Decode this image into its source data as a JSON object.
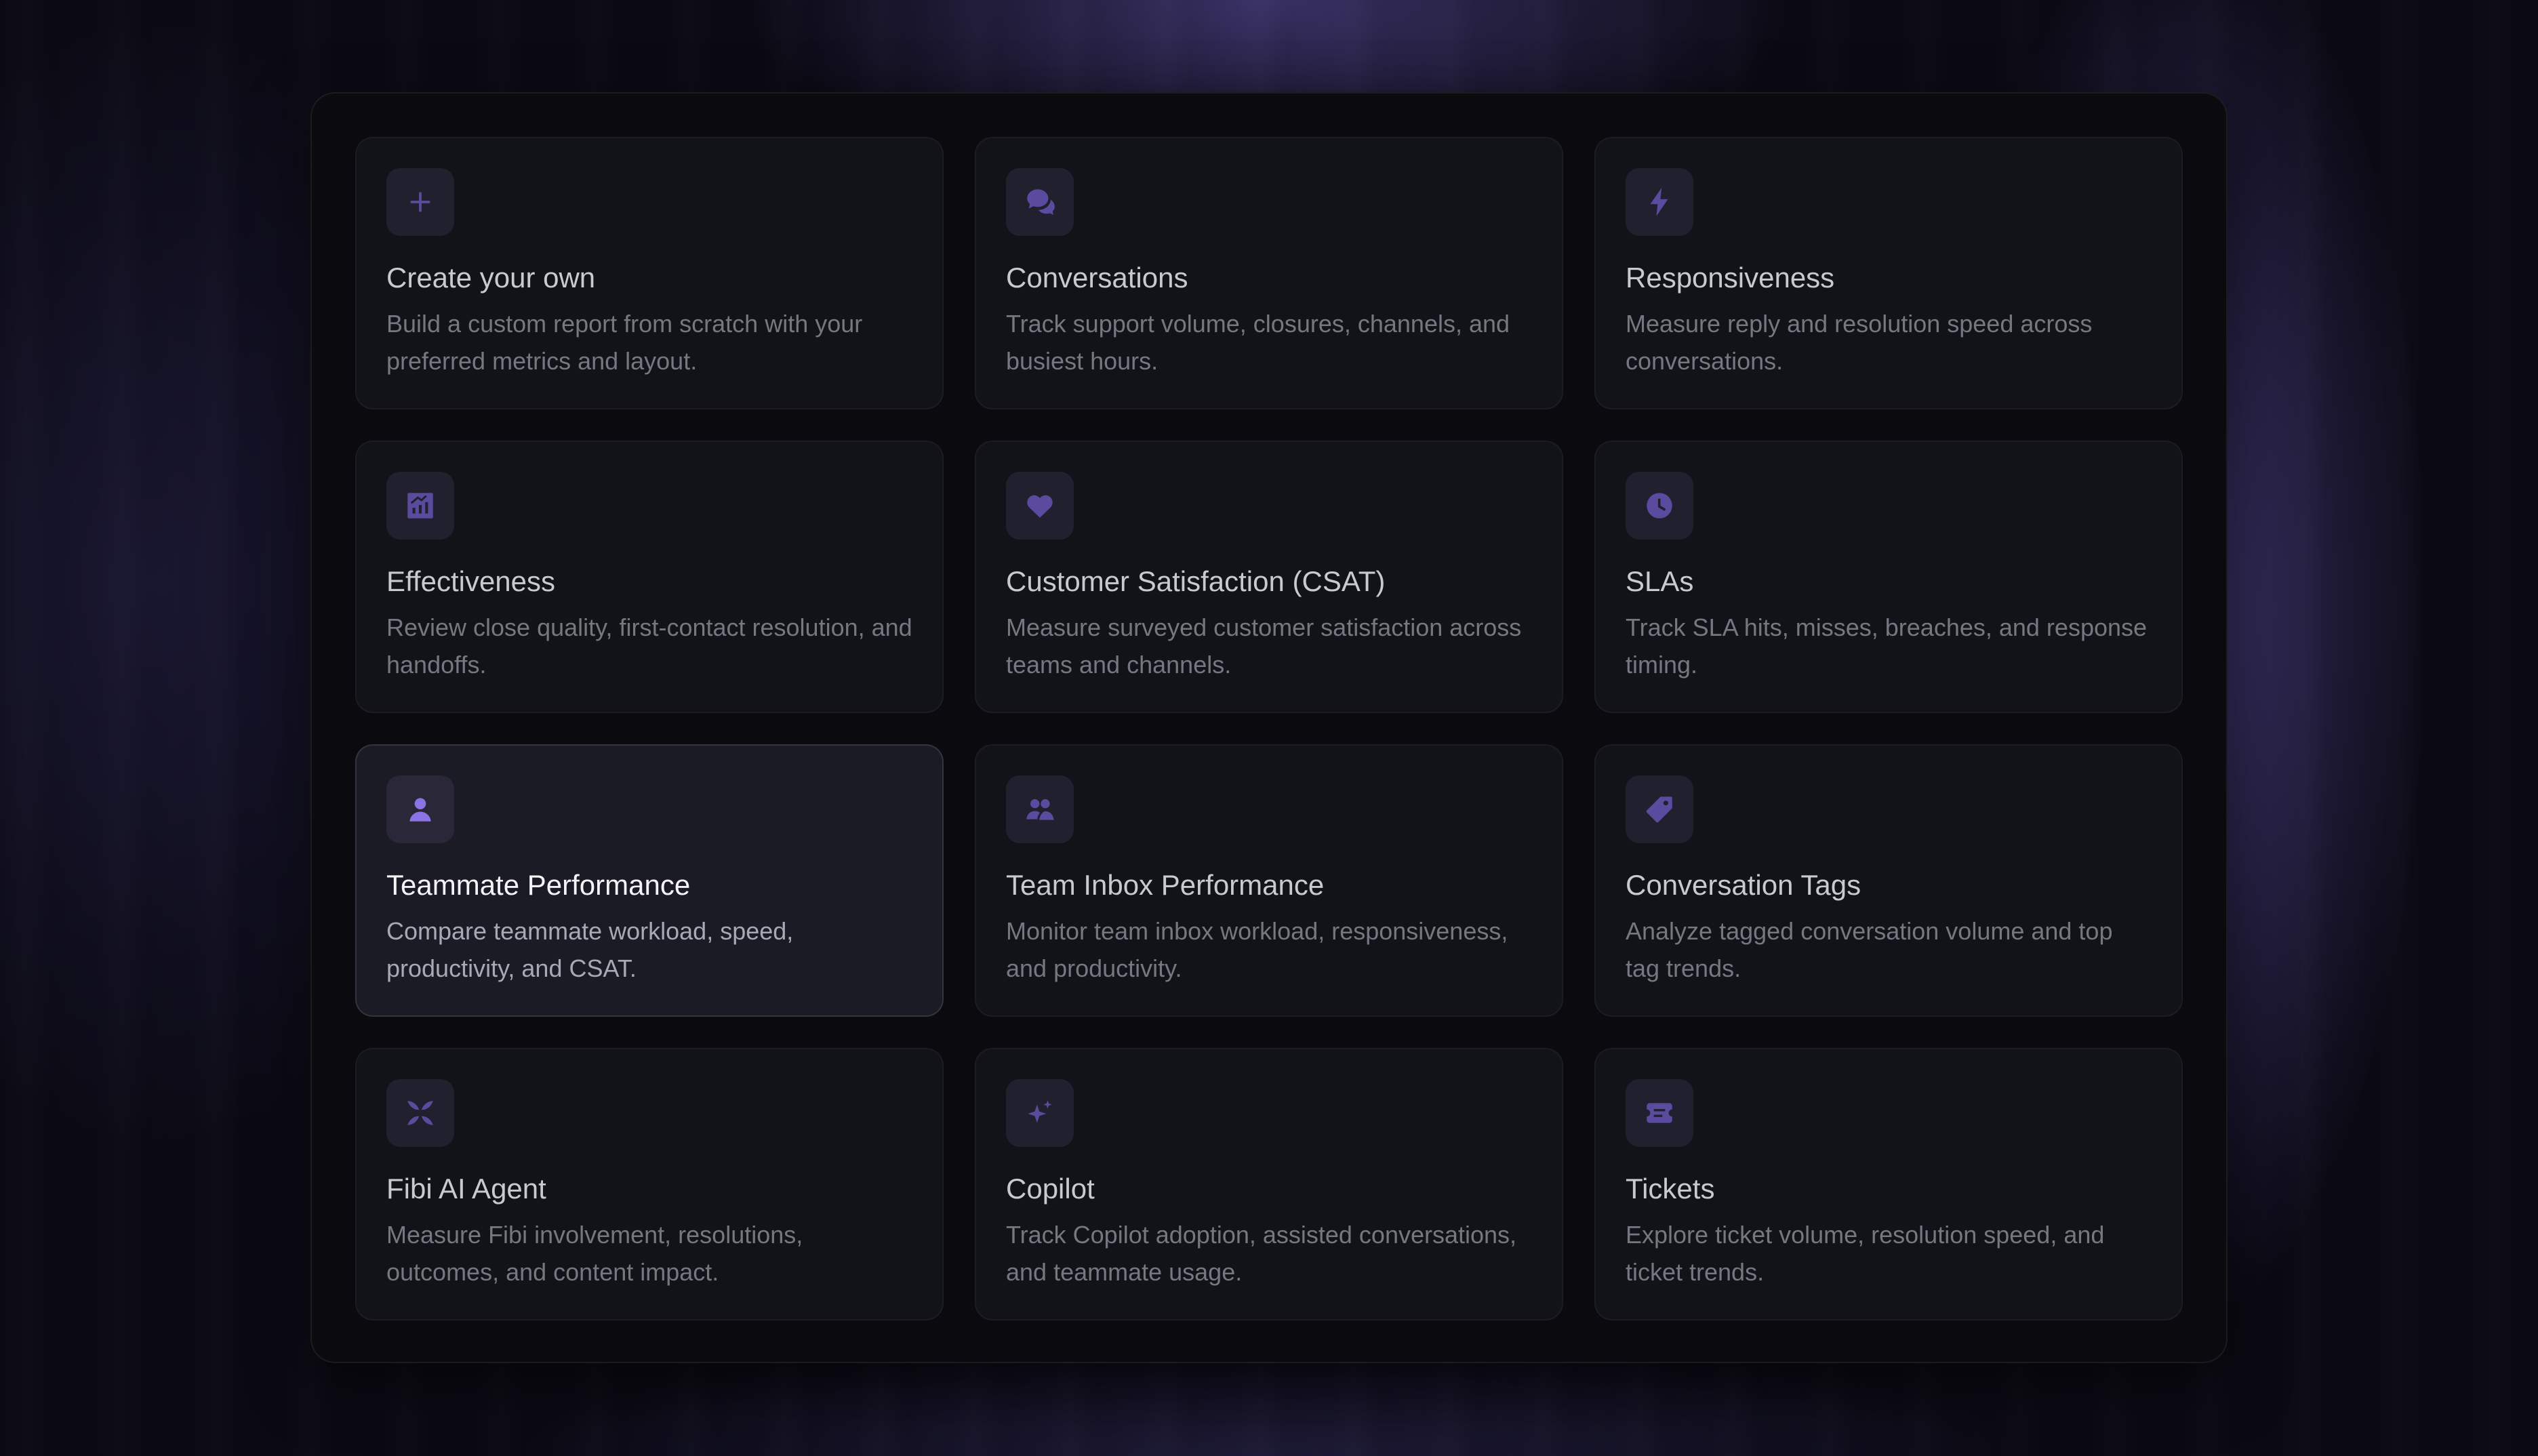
{
  "cards": [
    {
      "title": "Create your own",
      "description": "Build a custom report from scratch with your preferred metrics and layout.",
      "icon": "plus-icon"
    },
    {
      "title": "Conversations",
      "description": "Track support volume, closures, channels, and busiest hours.",
      "icon": "chat-bubbles-icon"
    },
    {
      "title": "Responsiveness",
      "description": "Measure reply and resolution speed across conversations.",
      "icon": "lightning-bolt-icon"
    },
    {
      "title": "Effectiveness",
      "description": "Review close quality, first-contact resolution, and handoffs.",
      "icon": "chart-growth-icon"
    },
    {
      "title": "Customer Satisfaction (CSAT)",
      "description": "Measure surveyed customer satisfaction across teams and channels.",
      "icon": "heart-icon"
    },
    {
      "title": "SLAs",
      "description": "Track SLA hits, misses, breaches, and response timing.",
      "icon": "clock-icon"
    },
    {
      "title": "Teammate Performance",
      "description": "Compare teammate workload, speed, productivity, and CSAT.",
      "icon": "person-icon",
      "active": true
    },
    {
      "title": "Team Inbox Performance",
      "description": "Monitor team inbox workload, responsiveness, and productivity.",
      "icon": "team-icon"
    },
    {
      "title": "Conversation Tags",
      "description": "Analyze tagged conversation volume and top tag trends.",
      "icon": "tag-icon"
    },
    {
      "title": "Fibi AI Agent",
      "description": "Measure Fibi involvement, resolutions, outcomes, and content impact.",
      "icon": "fibi-logo-icon"
    },
    {
      "title": "Copilot",
      "description": "Track Copilot adoption, assisted conversations, and teammate usage.",
      "icon": "sparkles-icon"
    },
    {
      "title": "Tickets",
      "description": "Explore ticket volume, resolution speed, and ticket trends.",
      "icon": "ticket-icon"
    }
  ],
  "colors": {
    "icon_accent": "#5b4b9e",
    "icon_accent_active": "#8b73e6",
    "card_background": "#121219",
    "card_background_active": "#1b1b26"
  }
}
